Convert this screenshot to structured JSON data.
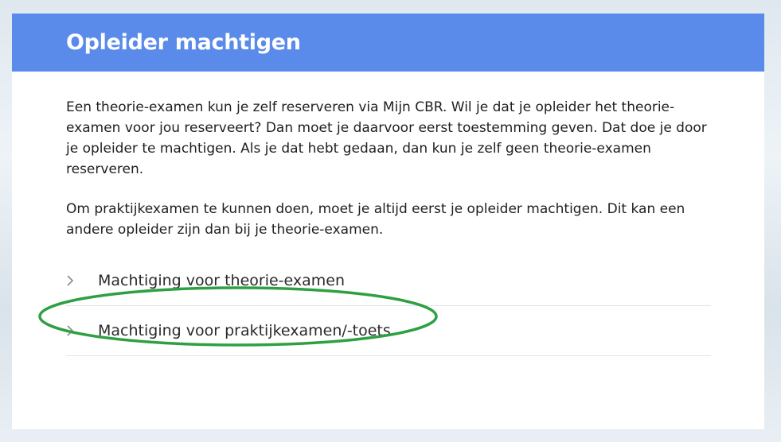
{
  "header": {
    "title": "Opleider machtigen"
  },
  "body": {
    "paragraphs": [
      "Een theorie-examen kun je zelf reserveren via Mijn CBR. Wil je dat je opleider het theorie-examen voor jou reserveert? Dan moet je daarvoor eerst toestemming geven. Dat doe je door je opleider te machtigen. Als je dat hebt gedaan, dan kun je zelf geen theorie-examen reserveren.",
      "Om praktijkexamen te kunnen doen, moet je altijd eerst je opleider machtigen. Dit kan een andere opleider zijn dan bij je theorie-examen."
    ]
  },
  "accordion": {
    "items": [
      {
        "label": "Machtiging voor theorie-examen",
        "icon": "chevron-right-icon"
      },
      {
        "label": "Machtiging voor praktijkexamen/-toets",
        "icon": "chevron-right-icon"
      }
    ]
  },
  "colors": {
    "header_bg": "#5a8bea",
    "annotation_ellipse": "#2ea043"
  }
}
